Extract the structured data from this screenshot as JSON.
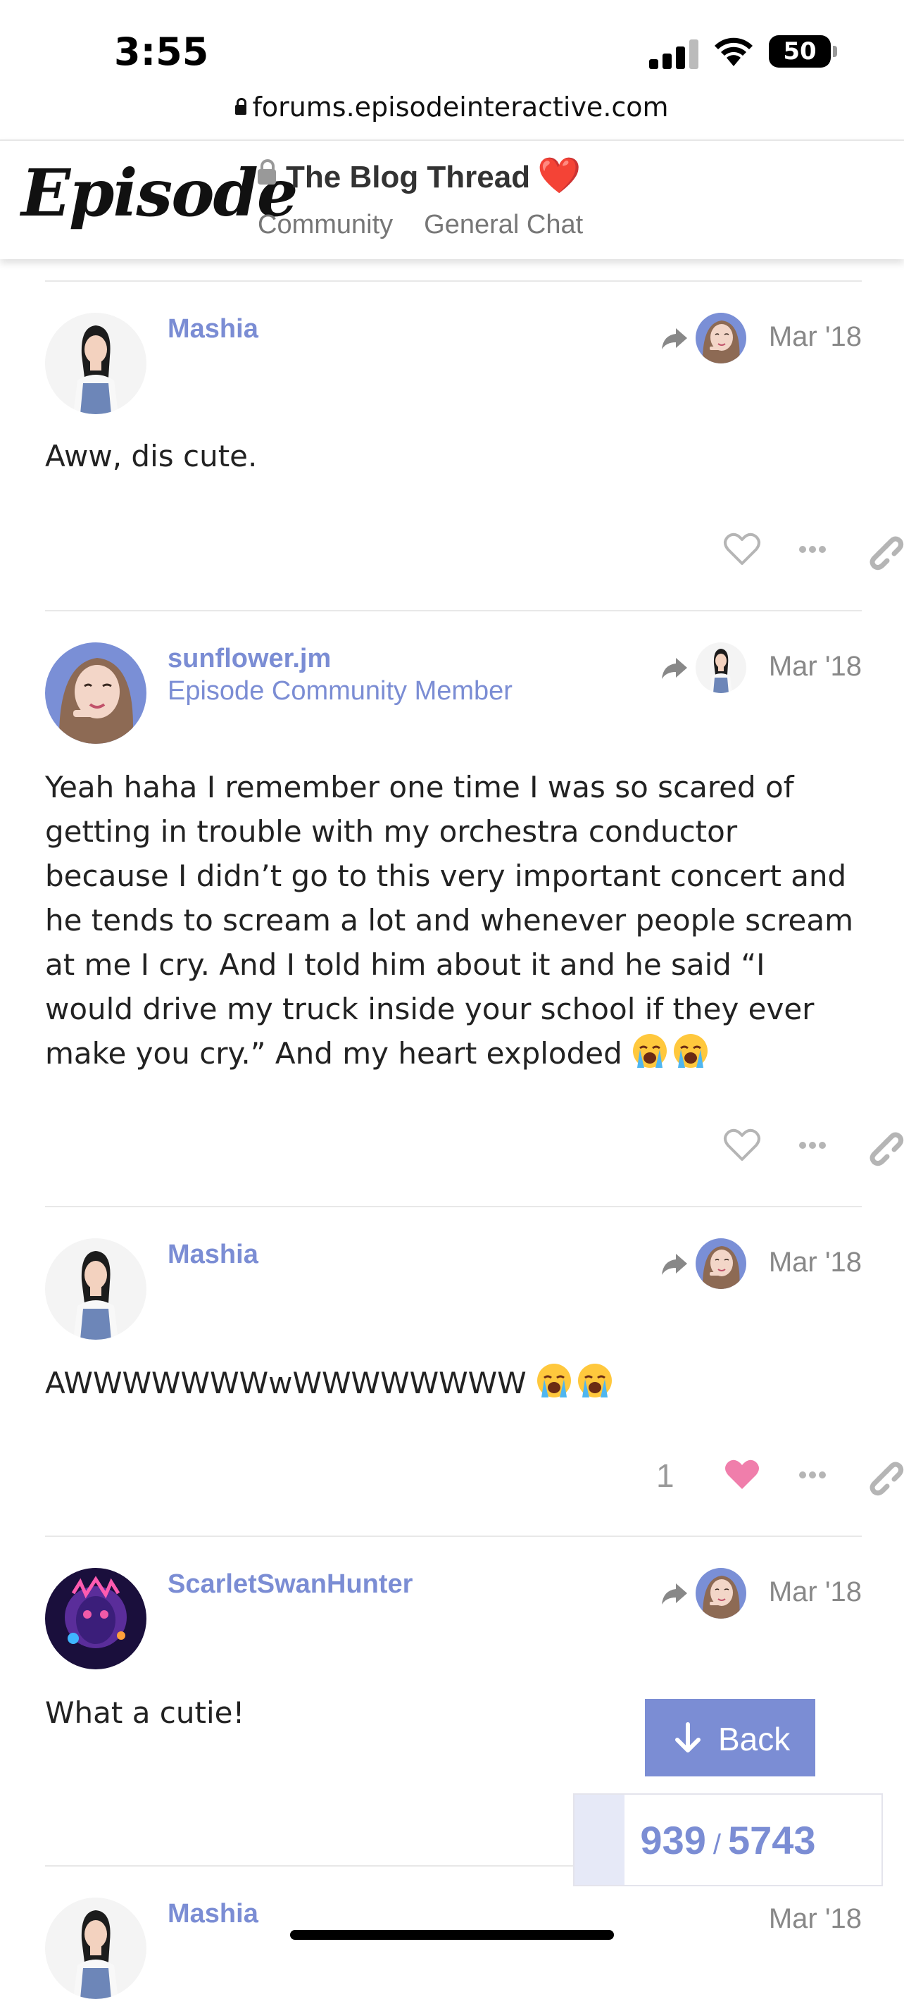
{
  "status_bar": {
    "time": "3:55",
    "battery": "50"
  },
  "browser": {
    "url": "forums.episodeinteractive.com"
  },
  "header": {
    "logo": "Episode",
    "thread_title": "The Blog Thread",
    "title_emoji": "❤️",
    "breadcrumbs": [
      "Community",
      "General Chat"
    ]
  },
  "posts": [
    {
      "username": "Mashia",
      "user_title": "",
      "date": "Mar '18",
      "text": "Aww, dis cute.",
      "likes": ""
    },
    {
      "username": "sunflower.jm",
      "user_title": "Episode Community Member",
      "date": "Mar '18",
      "text": "Yeah haha I remember one time I was so scared of getting in trouble with my orchestra conductor because I didn’t go to this very important concert and he tends to scream a lot and whenever people scream at me I cry. And I told him about it and he said “I would drive my truck inside your school if they ever make you cry.” And my heart exploded",
      "likes": ""
    },
    {
      "username": "Mashia",
      "user_title": "",
      "date": "Mar '18",
      "text": "AWWWWWWWwWWWWWWWW",
      "likes": "1"
    },
    {
      "username": "ScarletSwanHunter",
      "user_title": "",
      "date": "Mar '18",
      "text": "What a cutie!",
      "likes": ""
    },
    {
      "username": "Mashia",
      "user_title": "",
      "date": "Mar '18",
      "text": "",
      "likes": ""
    }
  ],
  "controls": {
    "back_label": "Back",
    "progress_current": "939",
    "progress_total": "5743",
    "progress_fraction": 0.1635
  },
  "colors": {
    "accent": "#7b8dd4",
    "like_heart": "#f07eab"
  },
  "icons": [
    "lock-icon",
    "reply-arrow-icon",
    "heart-icon",
    "ellipsis-icon",
    "link-icon",
    "arrow-down-icon",
    "crying-face-emoji"
  ]
}
